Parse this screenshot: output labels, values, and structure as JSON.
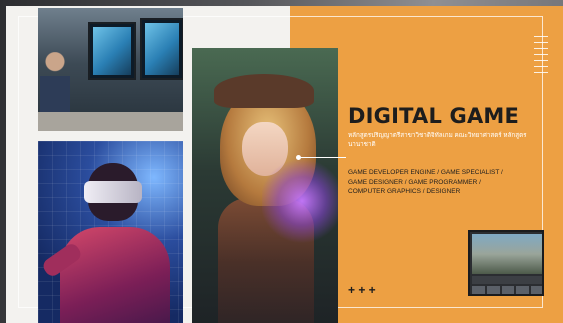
{
  "title": "DIGITAL GAME",
  "subtitle": "หลักสูตรปริญญาตรีสาขาวิชาดิจิทัลเกม คณะวิทยาศาสตร์ หลักสูตรนานาชาติ",
  "careers": [
    "GAME DEVELOPER ENGINE / GAME SPECIALIST /",
    "GAME DESIGNER / GAME PROGRAMMER /",
    "COMPUTER GRAPHICS / DESIGNER"
  ],
  "decor": {
    "plus_signs": "+ + +"
  },
  "colors": {
    "accent_orange": "#eda043",
    "board_white": "#f3f2ef",
    "text_dark": "#1d1d1d"
  }
}
